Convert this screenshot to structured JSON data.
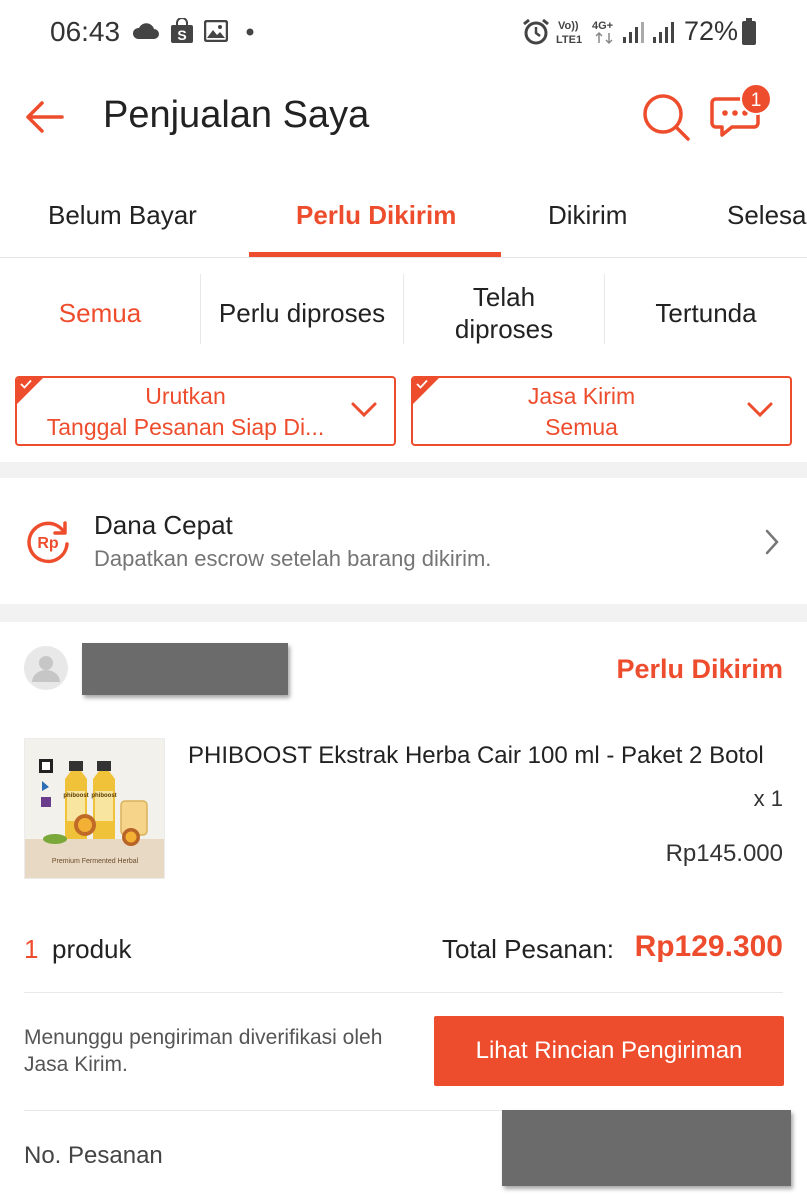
{
  "status_bar": {
    "time": "06:43",
    "network": "Vo)) LTE1",
    "network_type": "4G+",
    "battery": "72%"
  },
  "header": {
    "title": "Penjualan Saya",
    "chat_badge": "1",
    "icons": [
      "back-arrow-icon",
      "search-icon",
      "chat-icon"
    ]
  },
  "main_tabs": [
    {
      "label": "Belum Bayar",
      "active": false
    },
    {
      "label": "Perlu Dikirim",
      "active": true
    },
    {
      "label": "Dikirim",
      "active": false
    },
    {
      "label": "Selesai",
      "active": false
    }
  ],
  "sub_tabs": [
    {
      "label": "Semua",
      "active": true
    },
    {
      "label": "Perlu diproses",
      "active": false
    },
    {
      "label": "Telah diproses",
      "active": false
    },
    {
      "label": "Tertunda",
      "active": false
    }
  ],
  "filters": {
    "sort": {
      "label": "Urutkan",
      "value": "Tanggal Pesanan Siap Di..."
    },
    "courier": {
      "label": "Jasa Kirim",
      "value": "Semua"
    }
  },
  "dana_cepat": {
    "title": "Dana Cepat",
    "subtitle": "Dapatkan escrow setelah barang dikirim."
  },
  "order": {
    "status": "Perlu Dikirim",
    "product": {
      "name": "PHIBOOST Ekstrak Herba Cair 100 ml - Paket 2 Botol",
      "qty": "x 1",
      "price": "Rp145.000",
      "image_caption": "Premium Fermented Herbal",
      "bottle_label": "phiboost"
    },
    "count_number": "1",
    "count_label": "produk",
    "total_label": "Total Pesanan:",
    "total_value": "Rp129.300",
    "note": "Menunggu pengiriman diverifikasi oleh Jasa Kirim.",
    "button_label": "Lihat Rincian Pengiriman",
    "order_no_label": "No. Pesanan"
  },
  "colors": {
    "accent": "#ee4d2d",
    "divider": "#f2f2f2"
  }
}
